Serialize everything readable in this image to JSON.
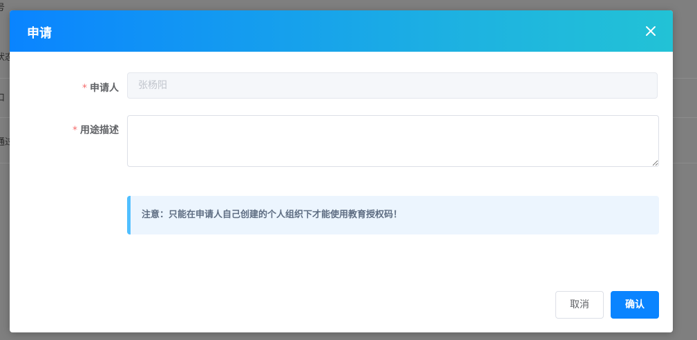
{
  "background": {
    "fragments": [
      "号",
      "状态",
      "口",
      "通过"
    ]
  },
  "dialog": {
    "title": "申请",
    "close_icon": "close-icon",
    "fields": {
      "applicant": {
        "required_mark": "*",
        "label": "申请人",
        "value": "张杨阳"
      },
      "purpose": {
        "required_mark": "*",
        "label": "用途描述",
        "value": ""
      }
    },
    "notice": "注意：只能在申请人自己创建的个人组织下才能使用教育授权码！",
    "buttons": {
      "cancel": "取消",
      "confirm": "确认"
    }
  },
  "colors": {
    "header_gradient_start": "#0a84ff",
    "header_gradient_end": "#22c2d6",
    "primary": "#0a84ff",
    "required": "#f56c6c",
    "notice_border": "#50bfff"
  }
}
